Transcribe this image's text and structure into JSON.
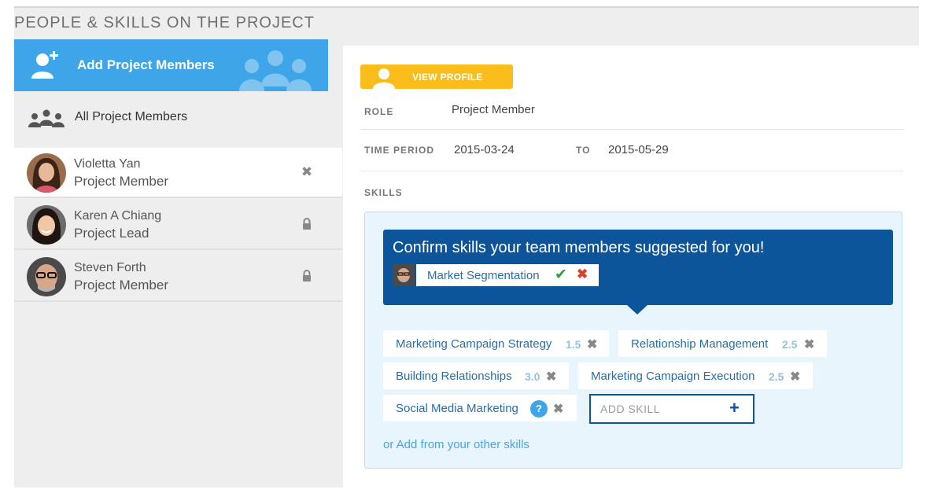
{
  "page": {
    "title": "PEOPLE & SKILLS ON THE PROJECT"
  },
  "sidebar": {
    "add_button_label": "Add Project Members",
    "all_members_label": "All Project Members",
    "members": [
      {
        "name": "Violetta Yan",
        "role": "Project Member",
        "action": "✖",
        "action_icon": "close-icon"
      },
      {
        "name": "Karen A Chiang",
        "role": "Project Lead",
        "action_icon": "lock-icon"
      },
      {
        "name": "Steven Forth",
        "role": "Project Member",
        "action_icon": "lock-icon"
      }
    ]
  },
  "detail": {
    "view_profile_label": "VIEW PROFILE",
    "role_label": "ROLE",
    "role_value": "Project Member",
    "time_label": "TIME PERIOD",
    "start_date": "2015-03-24",
    "to_label": "TO",
    "end_date": "2015-05-29",
    "skills_label": "SKILLS"
  },
  "suggestion": {
    "heading": "Confirm skills your team members suggested for you!",
    "skill": "Market Segmentation",
    "confirm_icon": "✔",
    "reject_icon": "✖"
  },
  "skills": [
    {
      "name": "Marketing Campaign Strategy",
      "score": "1.5"
    },
    {
      "name": "Relationship Management",
      "score": "2.5"
    },
    {
      "name": "Building Relationships",
      "score": "3.0"
    },
    {
      "name": "Marketing Campaign Execution",
      "score": "2.5"
    },
    {
      "name": "Social Media Marketing",
      "score": "?"
    }
  ],
  "remove_icon": "✖",
  "add_skill": {
    "placeholder": "ADD SKILL",
    "button": "+"
  },
  "other_skills_link": "or Add from your other skills",
  "colors": {
    "primary_blue": "#3ea5e8",
    "dark_blue": "#0d559a",
    "accent_yellow": "#fbbd1b",
    "confirm_green": "#2e9e46",
    "reject_red": "#d8402c"
  }
}
